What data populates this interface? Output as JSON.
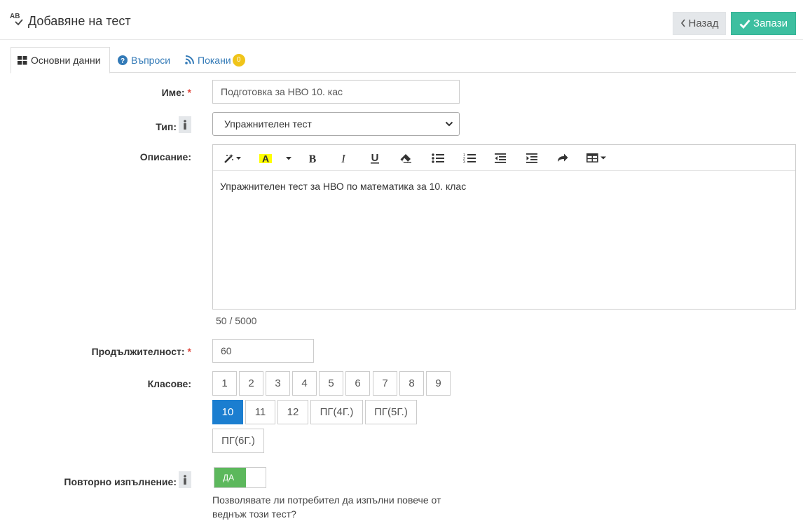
{
  "header": {
    "title": "Добавяне на тест",
    "title_icon": "ab-check-icon",
    "back_label": "Назад",
    "save_label": "Запази"
  },
  "tabs": [
    {
      "label": "Основни данни",
      "icon": "grid-icon",
      "active": true
    },
    {
      "label": "Въпроси",
      "icon": "question-circle-icon"
    },
    {
      "label": "Покани",
      "icon": "rss-icon",
      "badge": "0"
    }
  ],
  "form": {
    "name": {
      "label": "Име:",
      "required": "*",
      "value": "Подготовка за НВО 10. кас"
    },
    "type": {
      "label": "Тип:",
      "value": "Упражнителен тест"
    },
    "description": {
      "label": "Описание:",
      "value": "Упражнителен тест за НВО по математика за 10. клас",
      "counter": "50 / 5000"
    },
    "duration": {
      "label": "Продължителност:",
      "required": "*",
      "value": "60"
    },
    "grades": {
      "label": "Класове:",
      "options": [
        "1",
        "2",
        "3",
        "4",
        "5",
        "6",
        "7",
        "8",
        "9",
        "10",
        "11",
        "12",
        "ПГ(4Г.)",
        "ПГ(5Г.)",
        "ПГ(6Г.)"
      ],
      "selected": "10"
    },
    "repeat": {
      "label": "Повторно изпълнение:",
      "toggle_label": "ДА",
      "help": "Позволявате ли потребител да изпълни повече от веднъж този тест?"
    }
  },
  "colors": {
    "accent": "#3dbfa0",
    "primary": "#1b7ed0",
    "link": "#337ab7",
    "toggle_on": "#5cb85c",
    "badge": "#f0c419",
    "required": "#e0473d"
  }
}
